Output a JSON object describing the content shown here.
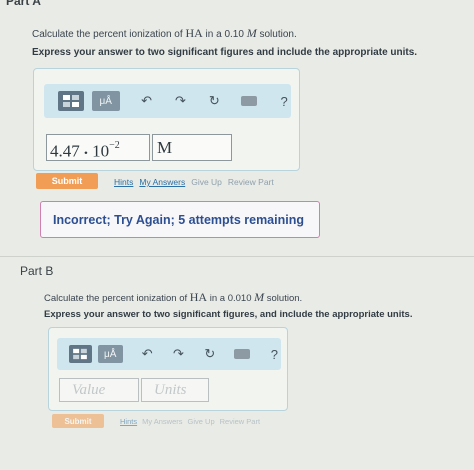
{
  "part_a": {
    "label": "Part A",
    "question": {
      "prefix": "Calculate the percent ionization of ",
      "species": "HA",
      "middle": " in a 0.10 ",
      "unit": "M",
      "suffix": " solution."
    },
    "instructions": "Express your answer to two significant figures and include the appropriate units.",
    "toolbar": {
      "mu_label": "μÅ",
      "help_label": "?"
    },
    "answer": {
      "mantissa": "4.47",
      "dot": "•",
      "base": "10",
      "exponent": "−2",
      "unit": "M"
    },
    "submit_label": "Submit",
    "links": [
      "Hints",
      "My Answers",
      "Give Up",
      "Review Part"
    ],
    "feedback": "Incorrect; Try Again; 5 attempts remaining"
  },
  "part_b": {
    "label": "Part B",
    "question": {
      "prefix": "Calculate the percent ionization of ",
      "species": "HA",
      "middle": " in a 0.010 ",
      "unit": "M",
      "suffix": " solution."
    },
    "instructions": "Express your answer to two significant figures, and include the appropriate units.",
    "toolbar": {
      "mu_label": "μÅ",
      "help_label": "?"
    },
    "value_placeholder": "Value",
    "units_placeholder": "Units",
    "submit_label": "Submit",
    "links": [
      "Hints",
      "My Answers",
      "Give Up",
      "Review Part"
    ]
  },
  "colors": {
    "accent": "#f29d55",
    "link": "#2b6fa5",
    "toolbar": "#cfe6ef",
    "feedback_border": "#cf7fb0"
  }
}
